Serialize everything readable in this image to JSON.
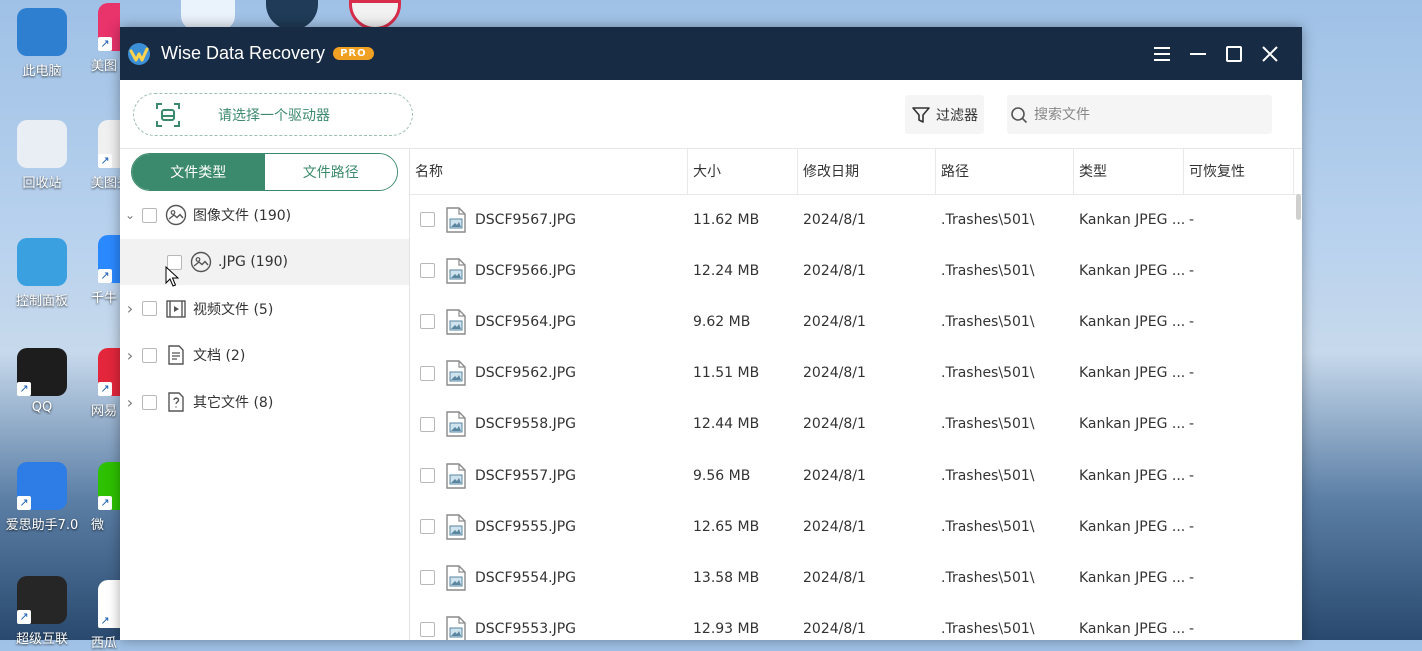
{
  "desktop": {
    "icons": [
      {
        "label": "此电脑",
        "name": "desktop-icon-this-pc",
        "color": "#2f7fd1"
      },
      {
        "label": "回收站",
        "name": "desktop-icon-recycle-bin",
        "color": "#e8eef4"
      },
      {
        "label": "控制面板",
        "name": "desktop-icon-control-panel",
        "color": "#3aa0e0"
      },
      {
        "label": "QQ",
        "name": "desktop-icon-qq",
        "color": "#1d1d1d"
      },
      {
        "label": "爱思助手7.0",
        "name": "desktop-icon-i4",
        "color": "#2e7ce6"
      },
      {
        "label": "超级互联",
        "name": "desktop-icon-super-link",
        "color": "#262626"
      }
    ],
    "second_column": [
      {
        "label": "美图",
        "name": "desktop-icon-meitu",
        "color": "#e8336b"
      },
      {
        "label": "美图秀",
        "name": "desktop-icon-meitu-xiu",
        "color": "#f0f0f0"
      },
      {
        "label": "千牛",
        "name": "desktop-icon-qianniu",
        "color": "#2b89ff"
      },
      {
        "label": "网易",
        "name": "desktop-icon-netease",
        "color": "#e3263b"
      },
      {
        "label": "微",
        "name": "desktop-icon-wechat",
        "color": "#2dc100"
      },
      {
        "label": "西瓜",
        "name": "desktop-icon-xigua",
        "color": "#ffffff"
      }
    ]
  },
  "window": {
    "title": "Wise Data Recovery",
    "badge": "PRO",
    "title_color": "#172b44",
    "accent": "#3c8a6d"
  },
  "toolbar": {
    "drive_placeholder": "请选择一个驱动器",
    "filter_label": "过滤器",
    "search_placeholder": "搜索文件"
  },
  "left": {
    "tabs": [
      {
        "label": "文件类型",
        "active": true
      },
      {
        "label": "文件路径",
        "active": false
      }
    ],
    "tree": [
      {
        "label": "图像文件 (190)",
        "icon": "image-icon",
        "expanded": true,
        "level": 0
      },
      {
        "label": ".JPG (190)",
        "icon": "image-icon",
        "level": 1,
        "selected": true
      },
      {
        "label": "视频文件 (5)",
        "icon": "video-icon",
        "expanded": false,
        "level": 0
      },
      {
        "label": "文档 (2)",
        "icon": "document-icon",
        "expanded": false,
        "level": 0
      },
      {
        "label": "其它文件 (8)",
        "icon": "unknown-file-icon",
        "expanded": false,
        "level": 0
      }
    ]
  },
  "table": {
    "columns": [
      "名称",
      "大小",
      "修改日期",
      "路径",
      "类型",
      "可恢复性"
    ],
    "rows": [
      {
        "name": "DSCF9567.JPG",
        "size": "11.62 MB",
        "date": "2024/8/1",
        "path": ".Trashes\\501\\",
        "type": "Kankan JPEG ...",
        "recoverability": "-"
      },
      {
        "name": "DSCF9566.JPG",
        "size": "12.24 MB",
        "date": "2024/8/1",
        "path": ".Trashes\\501\\",
        "type": "Kankan JPEG ...",
        "recoverability": "-"
      },
      {
        "name": "DSCF9564.JPG",
        "size": "9.62 MB",
        "date": "2024/8/1",
        "path": ".Trashes\\501\\",
        "type": "Kankan JPEG ...",
        "recoverability": "-"
      },
      {
        "name": "DSCF9562.JPG",
        "size": "11.51 MB",
        "date": "2024/8/1",
        "path": ".Trashes\\501\\",
        "type": "Kankan JPEG ...",
        "recoverability": "-"
      },
      {
        "name": "DSCF9558.JPG",
        "size": "12.44 MB",
        "date": "2024/8/1",
        "path": ".Trashes\\501\\",
        "type": "Kankan JPEG ...",
        "recoverability": "-"
      },
      {
        "name": "DSCF9557.JPG",
        "size": "9.56 MB",
        "date": "2024/8/1",
        "path": ".Trashes\\501\\",
        "type": "Kankan JPEG ...",
        "recoverability": "-"
      },
      {
        "name": "DSCF9555.JPG",
        "size": "12.65 MB",
        "date": "2024/8/1",
        "path": ".Trashes\\501\\",
        "type": "Kankan JPEG ...",
        "recoverability": "-"
      },
      {
        "name": "DSCF9554.JPG",
        "size": "13.58 MB",
        "date": "2024/8/1",
        "path": ".Trashes\\501\\",
        "type": "Kankan JPEG ...",
        "recoverability": "-"
      },
      {
        "name": "DSCF9553.JPG",
        "size": "12.93 MB",
        "date": "2024/8/1",
        "path": ".Trashes\\501\\",
        "type": "Kankan JPEG ...",
        "recoverability": "-"
      }
    ]
  }
}
